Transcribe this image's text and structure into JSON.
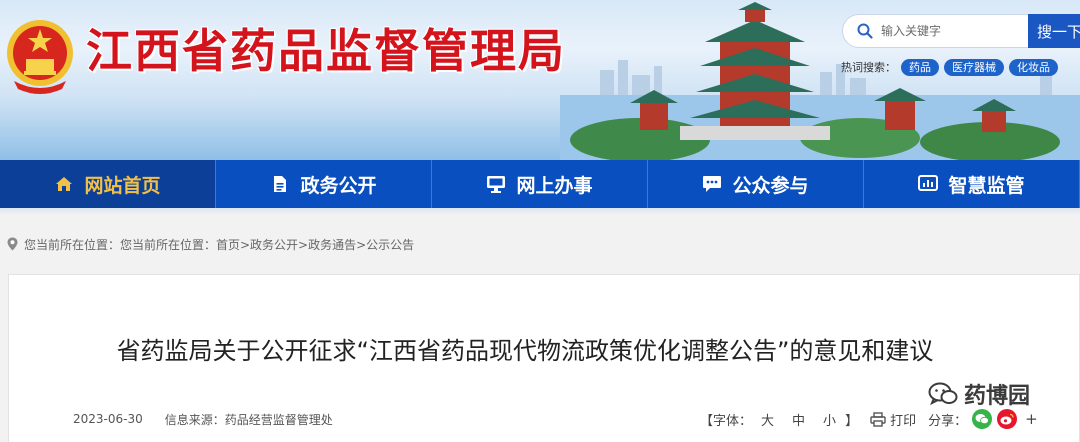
{
  "site": {
    "title": "江西省药品监督管理局"
  },
  "search": {
    "placeholder": "输入关键字",
    "button_label": "搜一下"
  },
  "hot_search": {
    "label": "热词搜索：",
    "tags": [
      "药品",
      "医疗器械",
      "化妆品"
    ]
  },
  "nav": {
    "items": [
      {
        "label": "网站首页",
        "icon": "home-icon",
        "active": true
      },
      {
        "label": "政务公开",
        "icon": "document-icon"
      },
      {
        "label": "网上办事",
        "icon": "monitor-icon"
      },
      {
        "label": "公众参与",
        "icon": "chat-icon"
      },
      {
        "label": "智慧监管",
        "icon": "dashboard-icon"
      }
    ]
  },
  "breadcrumb": {
    "text": "您当前所在位置：您当前所在位置：首页>政务公开>政务通告>公示公告"
  },
  "article": {
    "title": "省药监局关于公开征求“江西省药品现代物流政策优化调整公告”的意见和建议",
    "date": "2023-06-30",
    "source": "信息来源：药品经营监督管理处"
  },
  "tools": {
    "font_label": "【字体：",
    "font_large": "大",
    "font_medium": "中",
    "font_small": "小",
    "font_close": "】",
    "print_label": "打印",
    "share_label": "分享：",
    "more_label": "+"
  },
  "watermark": {
    "text": "药博园"
  },
  "colors": {
    "nav_bg": "#0a4fbf",
    "nav_active_bg": "#0c3f97",
    "nav_active_text": "#f1c04a",
    "title_red": "#d4141c",
    "search_btn": "#1b57c2",
    "tag_blue": "#1e63c9"
  }
}
